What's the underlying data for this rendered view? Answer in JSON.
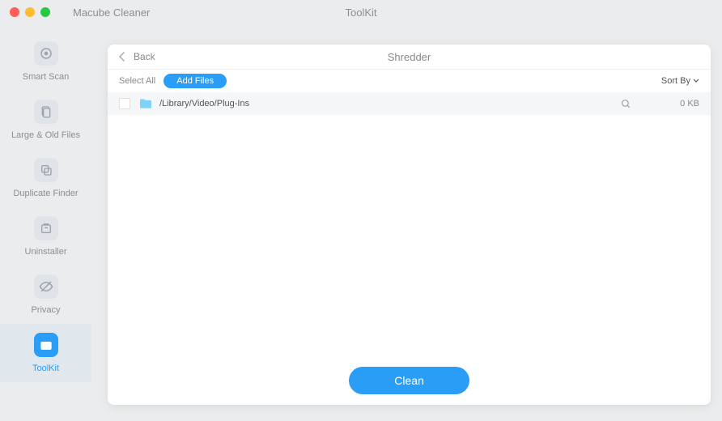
{
  "titlebar": {
    "appName": "Macube Cleaner",
    "windowTitle": "ToolKit"
  },
  "sidebar": {
    "items": [
      {
        "label": "Smart Scan"
      },
      {
        "label": "Large & Old Files"
      },
      {
        "label": "Duplicate Finder"
      },
      {
        "label": "Uninstaller"
      },
      {
        "label": "Privacy"
      },
      {
        "label": "ToolKit"
      }
    ]
  },
  "panel": {
    "backLabel": "Back",
    "title": "Shredder"
  },
  "toolbar": {
    "selectAll": "Select All",
    "addFiles": "Add Files",
    "sortBy": "Sort By"
  },
  "files": [
    {
      "path": "/Library/Video/Plug-Ins",
      "size": "0 KB"
    }
  ],
  "footer": {
    "cleanLabel": "Clean"
  }
}
